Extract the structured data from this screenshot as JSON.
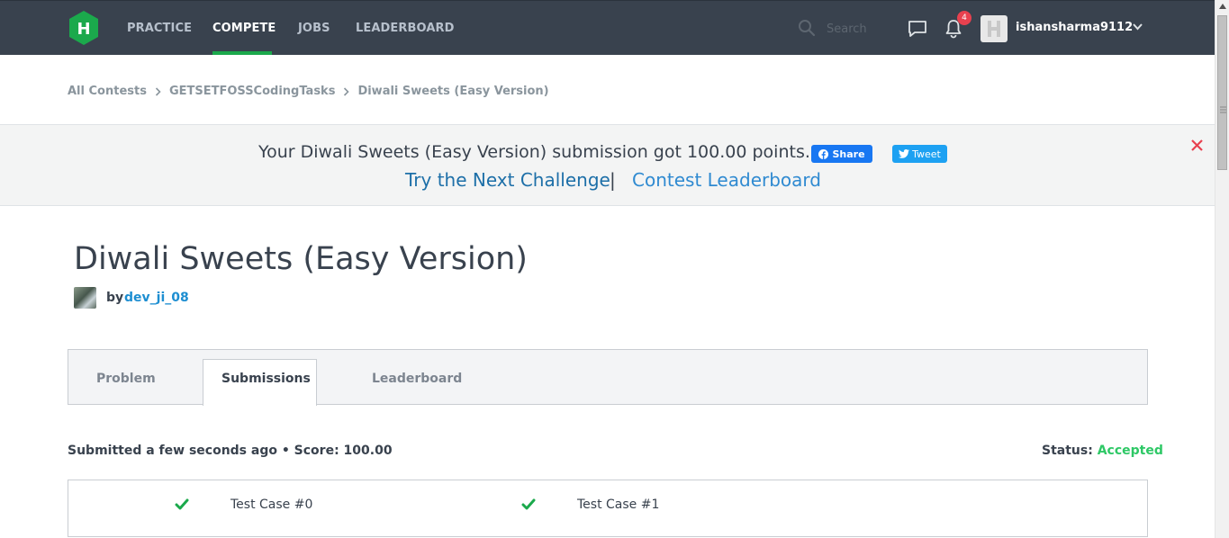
{
  "nav": {
    "items": [
      "PRACTICE",
      "COMPETE",
      "JOBS",
      "LEADERBOARD"
    ],
    "active": "COMPETE",
    "search_placeholder": "Search",
    "notification_count": "4",
    "username": "ishansharma9112",
    "accent_color": "#1ba94c"
  },
  "breadcrumb": {
    "items": [
      "All Contests",
      "GETSETFOSSCodingTasks",
      "Diwali Sweets (Easy Version)"
    ]
  },
  "banner": {
    "message": "Your Diwali Sweets (Easy Version) submission got 100.00 points.",
    "share_label": "Share",
    "tweet_label": "Tweet",
    "next_challenge": "Try the Next Challenge",
    "separator": "|",
    "contest_leaderboard": "Contest Leaderboard"
  },
  "challenge": {
    "title": "Diwali Sweets (Easy Version)",
    "by_label": "by",
    "author": "dev_ji_08"
  },
  "tabs": [
    "Problem",
    "Submissions",
    "Leaderboard"
  ],
  "active_tab": "Submissions",
  "submission": {
    "summary": "Submitted a few seconds ago • Score: 100.00",
    "status_label": "Status:",
    "status_value": "Accepted",
    "status_color": "#2ec866"
  },
  "test_cases": [
    {
      "label": "Test Case #0",
      "passed": true,
      "icon": "check-icon"
    },
    {
      "label": "Test Case #1",
      "passed": true,
      "icon": "check-icon"
    }
  ]
}
